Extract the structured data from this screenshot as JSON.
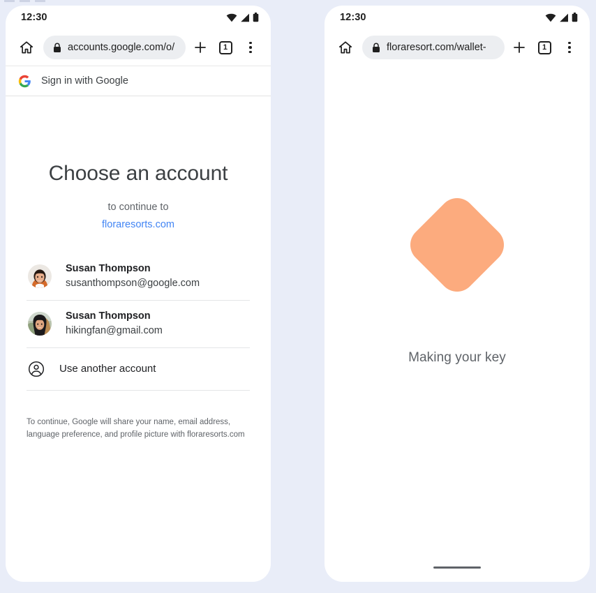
{
  "background_color": "#e9edf8",
  "phones": {
    "left": {
      "status": {
        "time": "12:30",
        "icons": [
          "wifi-icon",
          "signal-icon",
          "battery-icon"
        ]
      },
      "browser": {
        "home_icon": "home-icon",
        "lock_icon": "lock-icon",
        "url": "accounts.google.com/o/",
        "new_tab_icon": "plus-icon",
        "tab_count": "1",
        "menu_icon": "kebab-menu-icon"
      },
      "gsi_header": {
        "logo": "google-g-icon",
        "label": "Sign in with Google"
      },
      "chooser": {
        "title": "Choose an account",
        "subtitle": "to continue to",
        "domain": "floraresorts.com",
        "accounts": [
          {
            "name": "Susan Thompson",
            "email": "susanthompson@google.com",
            "avatar": "avatar-susan-google"
          },
          {
            "name": "Susan Thompson",
            "email": "hikingfan@gmail.com",
            "avatar": "avatar-susan-gmail"
          }
        ],
        "use_another": {
          "icon": "person-circle-icon",
          "label": "Use another account"
        },
        "disclaimer": "To continue, Google will share your name, email address, language preference, and profile picture with floraresorts.com"
      }
    },
    "right": {
      "status": {
        "time": "12:30",
        "icons": [
          "wifi-icon",
          "signal-icon",
          "battery-icon"
        ]
      },
      "browser": {
        "home_icon": "home-icon",
        "lock_icon": "lock-icon",
        "url": "floraresort.com/wallet-",
        "new_tab_icon": "plus-icon",
        "tab_count": "1",
        "menu_icon": "kebab-menu-icon"
      },
      "content": {
        "shape_color": "#fcab7e",
        "status_text": "Making your key"
      }
    }
  }
}
